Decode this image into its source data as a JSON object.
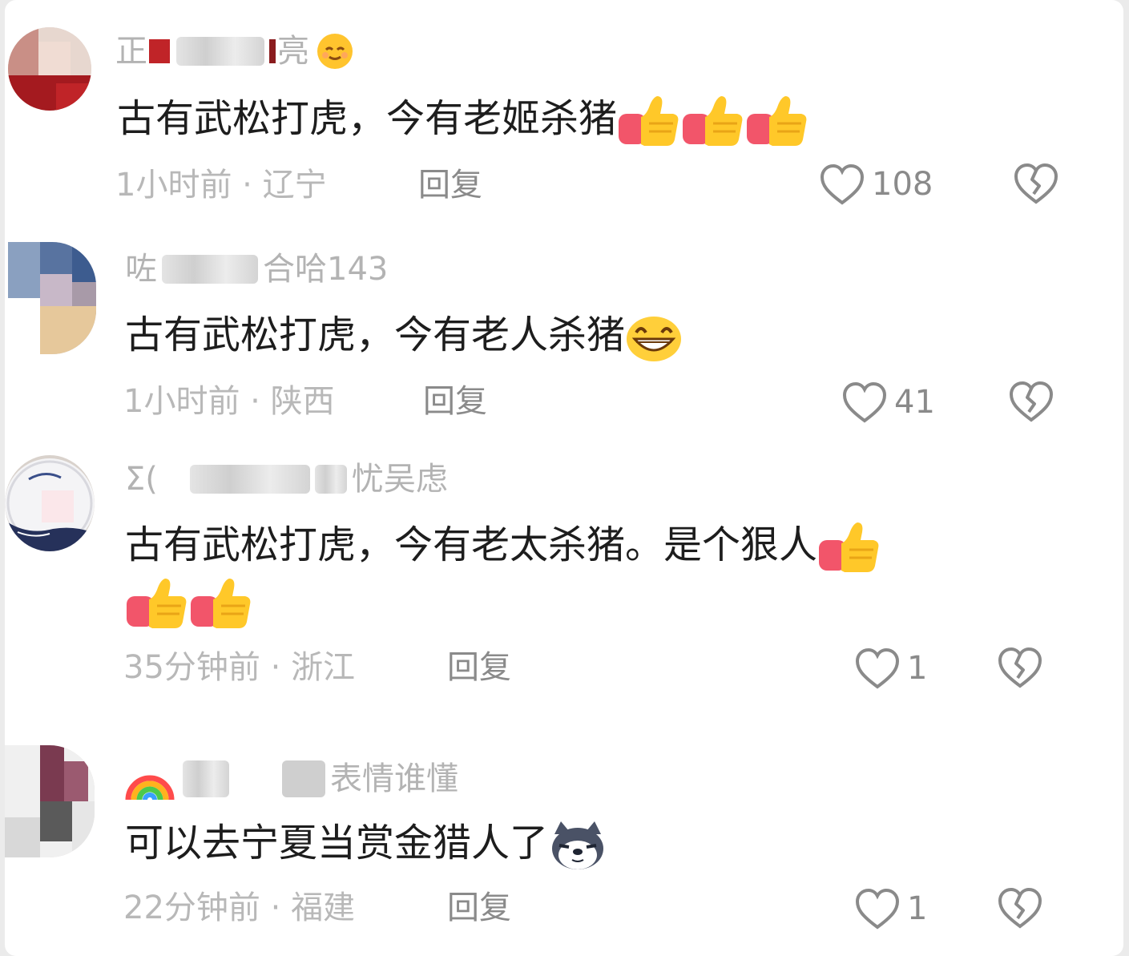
{
  "comments": [
    {
      "user_start": "正",
      "user_end": "亮",
      "text": "古有武松打虎，今有老姬杀猪",
      "time": "1小时前",
      "separator": "·",
      "location": "辽宁",
      "reply_label": "回复",
      "likes": "108",
      "emojis": [
        "thumbs-up",
        "thumbs-up",
        "thumbs-up"
      ],
      "name_emoji": "smile-face"
    },
    {
      "user_start": "咗",
      "user_end": "合哈143",
      "text": "古有武松打虎，今有老人杀猪",
      "time": "1小时前",
      "separator": "·",
      "location": "陕西",
      "reply_label": "回复",
      "likes": "41",
      "emojis": [
        "grin-face"
      ]
    },
    {
      "user_start": "Σ(",
      "user_end": "忧吴虑",
      "text": "古有武松打虎，今有老太杀猪。是个狠人",
      "time": "35分钟前",
      "separator": "·",
      "location": "浙江",
      "reply_label": "回复",
      "likes": "1",
      "emojis": [
        "thumbs-up",
        "thumbs-up",
        "thumbs-up"
      ]
    },
    {
      "user_start": "",
      "user_end": "表情谁懂",
      "text": "可以去宁夏当赏金猎人了",
      "time": "22分钟前",
      "separator": "·",
      "location": "福建",
      "reply_label": "回复",
      "likes": "1",
      "emojis": [
        "husky-face"
      ],
      "name_emoji": "rainbow"
    }
  ],
  "colors": {
    "background": "#ffffff",
    "text": "#1d1d1d",
    "muted": "#b8b8b8",
    "action": "#8a8a8a"
  }
}
